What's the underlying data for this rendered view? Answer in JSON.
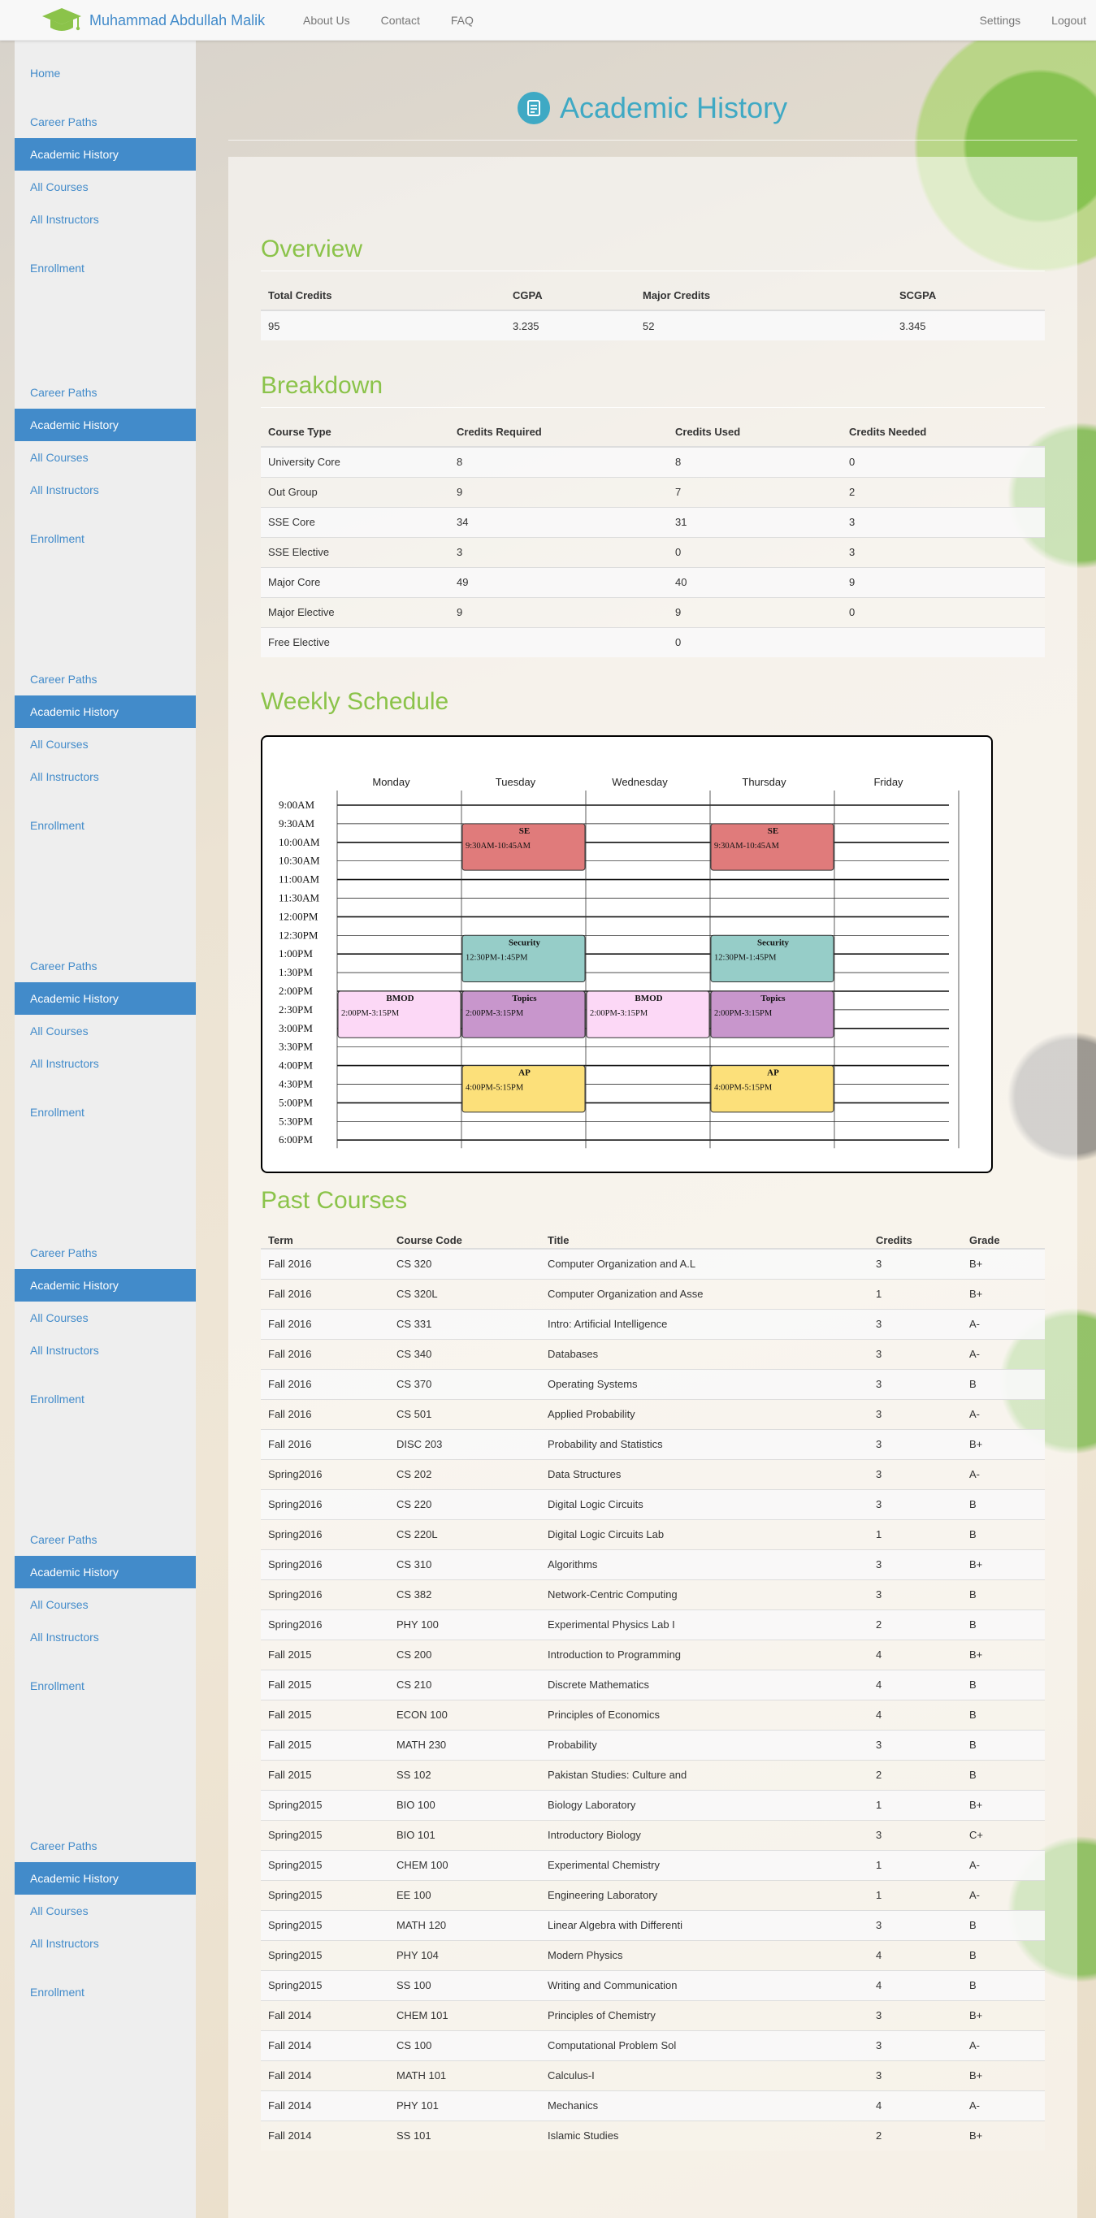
{
  "navbar": {
    "brand": "Muhammad Abdullah Malik",
    "links": [
      "About Us",
      "Contact",
      "FAQ"
    ],
    "right": [
      "Settings",
      "Logout"
    ]
  },
  "sidebar": {
    "home": "Home",
    "items": [
      "Career Paths",
      "Academic History",
      "All Courses",
      "All Instructors",
      "Enrollment"
    ],
    "active": "Academic History"
  },
  "page": {
    "title": "Academic History"
  },
  "overview": {
    "heading": "Overview",
    "columns": [
      "Total Credits",
      "CGPA",
      "Major Credits",
      "SCGPA"
    ],
    "row": [
      "95",
      "3.235",
      "52",
      "3.345"
    ]
  },
  "breakdown": {
    "heading": "Breakdown",
    "columns": [
      "Course Type",
      "Credits Required",
      "Credits Used",
      "Credits Needed"
    ],
    "rows": [
      [
        "University Core",
        "8",
        "8",
        "0"
      ],
      [
        "Out Group",
        "9",
        "7",
        "2"
      ],
      [
        "SSE Core",
        "34",
        "31",
        "3"
      ],
      [
        "SSE Elective",
        "3",
        "0",
        "3"
      ],
      [
        "Major Core",
        "49",
        "40",
        "9"
      ],
      [
        "Major Elective",
        "9",
        "9",
        "0"
      ],
      [
        "Free Elective",
        "",
        "0",
        ""
      ]
    ]
  },
  "schedule": {
    "heading": "Weekly Schedule",
    "days": [
      "Monday",
      "Tuesday",
      "Wednesday",
      "Thursday",
      "Friday"
    ],
    "times": [
      "9:00AM",
      "9:30AM",
      "10:00AM",
      "10:30AM",
      "11:00AM",
      "11:30AM",
      "12:00PM",
      "12:30PM",
      "1:00PM",
      "1:30PM",
      "2:00PM",
      "2:30PM",
      "3:00PM",
      "3:30PM",
      "4:00PM",
      "4:30PM",
      "5:00PM",
      "5:30PM",
      "6:00PM"
    ],
    "events": [
      {
        "name": "SE",
        "time": "9:30AM-10:45AM",
        "day": 1,
        "start": 1,
        "end": 3.5,
        "color": "#e07b7b"
      },
      {
        "name": "SE",
        "time": "9:30AM-10:45AM",
        "day": 3,
        "start": 1,
        "end": 3.5,
        "color": "#e07b7b"
      },
      {
        "name": "Security",
        "time": "12:30PM-1:45PM",
        "day": 1,
        "start": 7,
        "end": 9.5,
        "color": "#96cdc8"
      },
      {
        "name": "Security",
        "time": "12:30PM-1:45PM",
        "day": 3,
        "start": 7,
        "end": 9.5,
        "color": "#96cdc8"
      },
      {
        "name": "BMOD",
        "time": "2:00PM-3:15PM",
        "day": 0,
        "start": 10,
        "end": 12.5,
        "color": "#fcd8f6"
      },
      {
        "name": "Topics",
        "time": "2:00PM-3:15PM",
        "day": 1,
        "start": 10,
        "end": 12.5,
        "color": "#c896cc"
      },
      {
        "name": "BMOD",
        "time": "2:00PM-3:15PM",
        "day": 2,
        "start": 10,
        "end": 12.5,
        "color": "#fcd8f6"
      },
      {
        "name": "Topics",
        "time": "2:00PM-3:15PM",
        "day": 3,
        "start": 10,
        "end": 12.5,
        "color": "#c896cc"
      },
      {
        "name": "AP",
        "time": "4:00PM-5:15PM",
        "day": 1,
        "start": 14,
        "end": 16.5,
        "color": "#fce07a"
      },
      {
        "name": "AP",
        "time": "4:00PM-5:15PM",
        "day": 3,
        "start": 14,
        "end": 16.5,
        "color": "#fce07a"
      }
    ]
  },
  "past": {
    "heading": "Past Courses",
    "columns": [
      "Term",
      "Course Code",
      "Title",
      "Credits",
      "Grade"
    ],
    "rows": [
      [
        "Fall 2016",
        "CS 320",
        "Computer Organization and A.L",
        "3",
        "B+"
      ],
      [
        "Fall 2016",
        "CS 320L",
        "Computer Organization and Asse",
        "1",
        "B+"
      ],
      [
        "Fall 2016",
        "CS 331",
        "Intro: Artificial Intelligence",
        "3",
        "A-"
      ],
      [
        "Fall 2016",
        "CS 340",
        "Databases",
        "3",
        "A-"
      ],
      [
        "Fall 2016",
        "CS 370",
        "Operating Systems",
        "3",
        "B"
      ],
      [
        "Fall 2016",
        "CS 501",
        "Applied Probability",
        "3",
        "A-"
      ],
      [
        "Fall 2016",
        "DISC 203",
        "Probability and Statistics",
        "3",
        "B+"
      ],
      [
        "Spring2016",
        "CS 202",
        "Data Structures",
        "3",
        "A-"
      ],
      [
        "Spring2016",
        "CS 220",
        "Digital Logic Circuits",
        "3",
        "B"
      ],
      [
        "Spring2016",
        "CS 220L",
        "Digital Logic Circuits Lab",
        "1",
        "B"
      ],
      [
        "Spring2016",
        "CS 310",
        "Algorithms",
        "3",
        "B+"
      ],
      [
        "Spring2016",
        "CS 382",
        "Network-Centric Computing",
        "3",
        "B"
      ],
      [
        "Spring2016",
        "PHY 100",
        "Experimental Physics Lab I",
        "2",
        "B"
      ],
      [
        "Fall 2015",
        "CS 200",
        "Introduction to Programming",
        "4",
        "B+"
      ],
      [
        "Fall 2015",
        "CS 210",
        "Discrete Mathematics",
        "4",
        "B"
      ],
      [
        "Fall 2015",
        "ECON 100",
        "Principles of Economics",
        "4",
        "B"
      ],
      [
        "Fall 2015",
        "MATH 230",
        "Probability",
        "3",
        "B"
      ],
      [
        "Fall 2015",
        "SS 102",
        "Pakistan Studies: Culture and",
        "2",
        "B"
      ],
      [
        "Spring2015",
        "BIO 100",
        "Biology Laboratory",
        "1",
        "B+"
      ],
      [
        "Spring2015",
        "BIO 101",
        "Introductory Biology",
        "3",
        "C+"
      ],
      [
        "Spring2015",
        "CHEM 100",
        "Experimental Chemistry",
        "1",
        "A-"
      ],
      [
        "Spring2015",
        "EE 100",
        "Engineering Laboratory",
        "1",
        "A-"
      ],
      [
        "Spring2015",
        "MATH 120",
        "Linear Algebra with Differenti",
        "3",
        "B"
      ],
      [
        "Spring2015",
        "PHY 104",
        "Modern Physics",
        "4",
        "B"
      ],
      [
        "Spring2015",
        "SS 100",
        "Writing and Communication",
        "4",
        "B"
      ],
      [
        "Fall 2014",
        "CHEM 101",
        "Principles of Chemistry",
        "3",
        "B+"
      ],
      [
        "Fall 2014",
        "CS 100",
        "Computational Problem Sol",
        "3",
        "A-"
      ],
      [
        "Fall 2014",
        "MATH 101",
        "Calculus-I",
        "3",
        "B+"
      ],
      [
        "Fall 2014",
        "PHY 101",
        "Mechanics",
        "4",
        "A-"
      ],
      [
        "Fall 2014",
        "SS 101",
        "Islamic Studies",
        "2",
        "B+"
      ]
    ]
  },
  "colors": {
    "accent": "#428bca",
    "heading": "#8bc34a",
    "title": "#3fa9c4"
  }
}
